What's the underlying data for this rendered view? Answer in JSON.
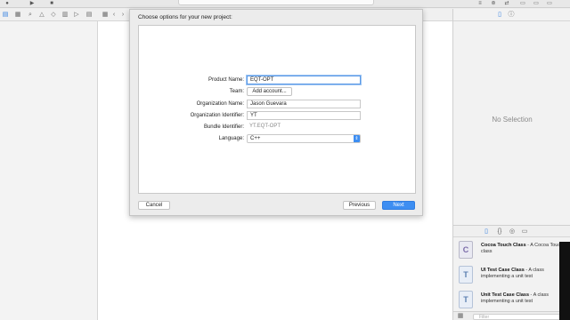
{
  "toolbar": {
    "run_icon": "play-icon",
    "stop_icon": "stop-icon"
  },
  "navigator": {
    "icons": [
      "folder-icon",
      "symbol-icon",
      "search-icon",
      "warning-icon",
      "test-icon",
      "debug-icon",
      "breakpoint-icon",
      "report-icon"
    ]
  },
  "dialog": {
    "title": "Choose options for your new project:",
    "product_name": {
      "label": "Product Name:",
      "value": "EQT-OPT"
    },
    "team": {
      "label": "Team:",
      "button": "Add account..."
    },
    "organization_name": {
      "label": "Organization Name:",
      "value": "Jason Guevara"
    },
    "organization_identifier": {
      "label": "Organization Identifier:",
      "value": "YT"
    },
    "bundle_identifier": {
      "label": "Bundle Identifier:",
      "value": "YT.EQT-OPT"
    },
    "language": {
      "label": "Language:",
      "value": "C++"
    },
    "cancel": "Cancel",
    "previous": "Previous",
    "next": "Next"
  },
  "inspector": {
    "no_selection": "No Selection"
  },
  "library": {
    "items": [
      {
        "icon": "C",
        "title": "Cocoa Touch Class",
        "desc": " - A Cocoa Touch class"
      },
      {
        "icon": "T",
        "title": "UI Test Case Class",
        "desc": " - A class implementing a unit test"
      },
      {
        "icon": "T",
        "title": "Unit Test Case Class",
        "desc": " - A class implementing a unit test"
      }
    ],
    "filter_placeholder": "Filter"
  },
  "colors": {
    "accent": "#3d8ef2",
    "sheet_bg": "#ececec"
  }
}
